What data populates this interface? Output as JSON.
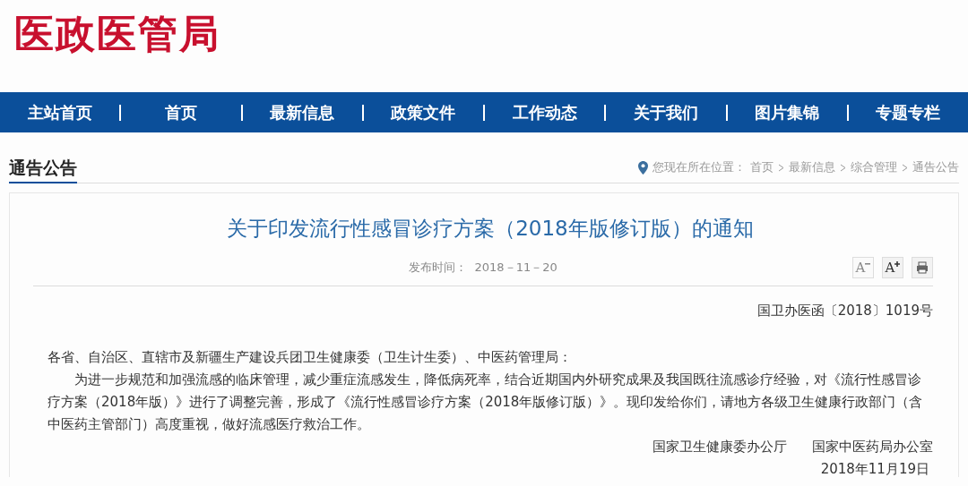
{
  "site_title": "医政医管局",
  "nav": [
    {
      "label": "主站首页"
    },
    {
      "label": "首页"
    },
    {
      "label": "最新信息"
    },
    {
      "label": "政策文件"
    },
    {
      "label": "工作动态"
    },
    {
      "label": "关于我们"
    },
    {
      "label": "图片集锦"
    },
    {
      "label": "专题专栏"
    }
  ],
  "section_title": "通告公告",
  "breadcrumb": {
    "prefix": "您现在所在位置：",
    "items": [
      "首页",
      "最新信息",
      "综合管理",
      "通告公告"
    ]
  },
  "article": {
    "title": "关于印发流行性感冒诊疗方案（2018年版修订版）的通知",
    "publish_label": "发布时间：",
    "publish_date": "2018－11－20",
    "tools": [
      {
        "kind": "shrink",
        "label": "A",
        "disabled": true
      },
      {
        "kind": "enlarge",
        "label": "A",
        "disabled": false
      },
      {
        "kind": "print"
      }
    ],
    "doc_number": "国卫办医函〔2018〕1019号",
    "salutation": "各省、自治区、直辖市及新疆生产建设兵团卫生健康委（卫生计生委）、中医药管理局：",
    "body": "为进一步规范和加强流感的临床管理，减少重症流感发生，降低病死率，结合近期国内外研究成果及我国既往流感诊疗经验，对《流行性感冒诊疗方案（2018年版）》进行了调整完善，形成了《流行性感冒诊疗方案（2018年版修订版）》。现印发给你们，请地方各级卫生健康行政部门（含中医药主管部门）高度重视，做好流感医疗救治工作。",
    "issuers": [
      "国家卫生健康委办公厅",
      "国家中医药局办公室"
    ],
    "date": "2018年11月19日"
  }
}
